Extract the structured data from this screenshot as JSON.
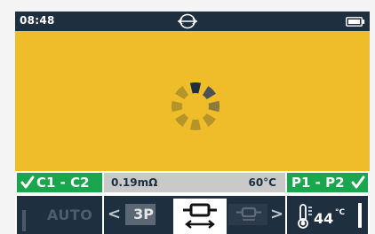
{
  "status_bar": {
    "time": "08:48",
    "center_icon": "connection-icon",
    "battery_icon": "battery-icon"
  },
  "main": {
    "background_color": "#efbc2a",
    "indicator": "loading-spinner"
  },
  "measurement": {
    "left_badge": "C1 - C2",
    "resistance": "0.19mΩ",
    "temperature": "60°C",
    "right_badge": "P1 - P2",
    "badge_color": "#1aa64c"
  },
  "toolbar": {
    "auto_label": "AUTO",
    "mode_prev": "3P",
    "active_mode_icon": "clamp-probe-icon",
    "next_mode_icon": "clamp-probe-icon",
    "probe_temperature": "44",
    "probe_temperature_unit": "°C",
    "dark_color": "#1e2f3f"
  }
}
